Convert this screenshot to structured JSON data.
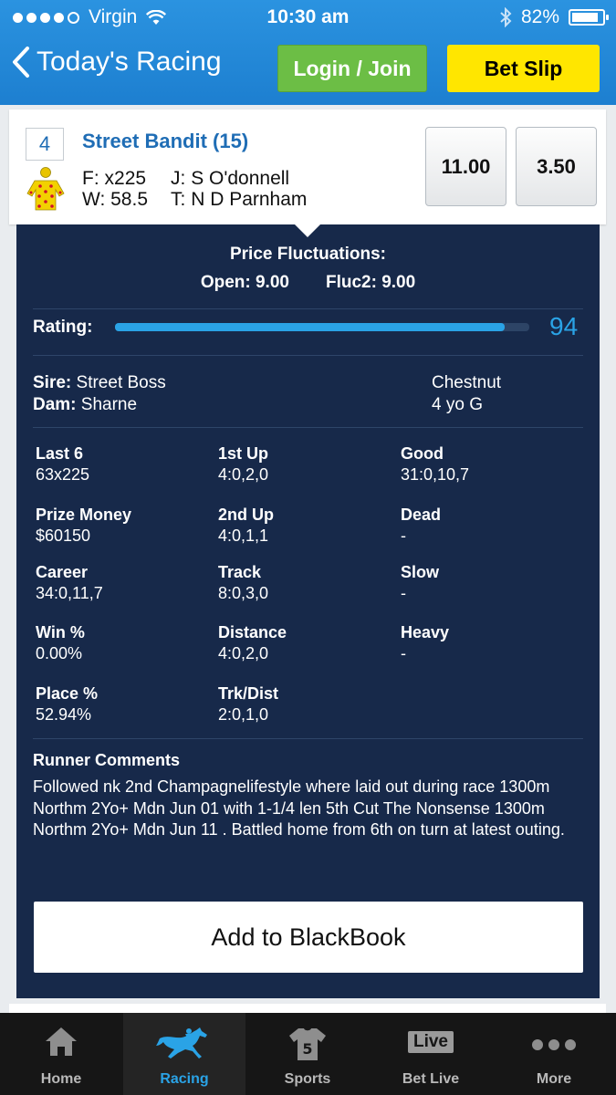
{
  "status_bar": {
    "carrier": "Virgin",
    "time": "10:30 am",
    "battery": "82%"
  },
  "nav": {
    "back_label": "Today's Racing",
    "login_label": "Login / Join",
    "betslip_label": "Bet Slip"
  },
  "runner": {
    "number": "4",
    "name": "Street Bandit (15)",
    "form_label": "F:",
    "form": "x225",
    "weight_label": "W:",
    "weight": "58.5",
    "jockey_label": "J:",
    "jockey": "S O'donnell",
    "trainer_label": "T:",
    "trainer": "N D Parnham",
    "win_odds": "11.00",
    "place_odds": "3.50"
  },
  "details": {
    "fluct_title": "Price Fluctuations:",
    "open": "Open: 9.00",
    "fluc2": "Fluc2: 9.00",
    "rating_label": "Rating:",
    "rating": "94",
    "rating_fraction": 0.94,
    "sire_label": "Sire:",
    "sire": "Street Boss",
    "dam_label": "Dam:",
    "dam": "Sharne",
    "colour": "Chestnut",
    "age_sex": "4 yo G",
    "stats": [
      {
        "title": "Last 6",
        "value": "63x225"
      },
      {
        "title": "1st Up",
        "value": "4:0,2,0"
      },
      {
        "title": "Good",
        "value": "31:0,10,7"
      },
      {
        "title": "Prize Money",
        "value": "$60150"
      },
      {
        "title": "2nd Up",
        "value": "4:0,1,1"
      },
      {
        "title": "Dead",
        "value": "-"
      },
      {
        "title": "Career",
        "value": "34:0,11,7"
      },
      {
        "title": "Track",
        "value": "8:0,3,0"
      },
      {
        "title": "Slow",
        "value": "-"
      },
      {
        "title": "Win %",
        "value": "0.00%"
      },
      {
        "title": "Distance",
        "value": "4:0,2,0"
      },
      {
        "title": "Heavy",
        "value": "-"
      },
      {
        "title": "Place %",
        "value": "52.94%"
      },
      {
        "title": "Trk/Dist",
        "value": "2:0,1,0"
      }
    ],
    "comments_title": "Runner Comments",
    "comments": "Followed nk 2nd Champagnelifestyle where laid out during race 1300m Northm 2Yo+ Mdn Jun 01 with 1-1/4 len 5th Cut The Nonsense 1300m Northm 2Yo+ Mdn Jun 11 . Battled home from 6th on turn at latest outing.",
    "add_blackbook": "Add to BlackBook"
  },
  "tabs": [
    {
      "label": "Home",
      "icon": "home-icon"
    },
    {
      "label": "Racing",
      "icon": "horse-icon"
    },
    {
      "label": "Sports",
      "icon": "jersey-icon",
      "jersey_number": "5"
    },
    {
      "label": "Bet Live",
      "icon": "live-icon",
      "badge": "Live"
    },
    {
      "label": "More",
      "icon": "more-icon"
    }
  ],
  "colors": {
    "header_blue": "#1d7fd0",
    "panel_navy": "#17294a",
    "accent": "#2aa3e6",
    "login_green": "#6cbe45",
    "betslip_yellow": "#ffe600"
  }
}
